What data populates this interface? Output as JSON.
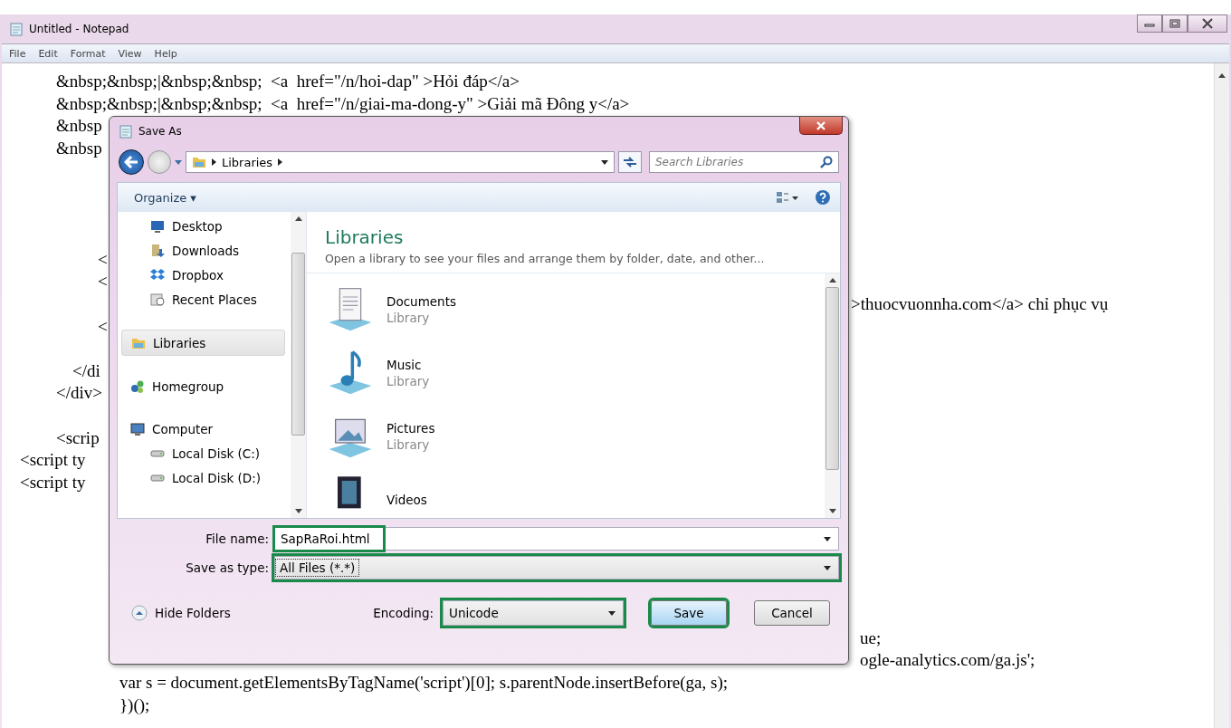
{
  "notepad": {
    "title": "Untitled - Notepad",
    "menu": [
      "File",
      "Edit",
      "Format",
      "View",
      "Help"
    ],
    "lines": [
      {
        "text": "&nbsp;&nbsp;|&nbsp;&nbsp;  <a  href=\"/n/hoi-dap\" >Hỏi đáp</a>"
      },
      {
        "text": "&nbsp;&nbsp;|&nbsp;&nbsp;  <a  href=\"/n/giai-ma-dong-y\" >Giải mã Đông y</a>"
      },
      {
        "text": "&nbsp"
      },
      {
        "text": "&nbsp"
      },
      {
        "text": "<"
      },
      {
        "text": "<"
      },
      {
        "text": ">thuocvuonnha.com</a> chỉ phục vụ"
      },
      {
        "text": "<"
      },
      {
        "text": "</di"
      },
      {
        "text": "</div>"
      },
      {
        "text": "<scrip"
      },
      {
        "text": "<script ty"
      },
      {
        "text": "<script ty"
      },
      {
        "text": "ue;"
      },
      {
        "text": "ogle-analytics.com/ga.js';"
      },
      {
        "text": "var s = document.getElementsByTagName('script')[0]; s.parentNode.insertBefore(ga, s);"
      },
      {
        "text": "})();"
      }
    ]
  },
  "dialog": {
    "title": "Save As",
    "address": "Libraries",
    "search": {
      "placeholder": "Search Libraries"
    },
    "organize": "Organize ▾",
    "nav_items": [
      {
        "label": "Desktop",
        "selected": false
      },
      {
        "label": "Downloads",
        "selected": false
      },
      {
        "label": "Dropbox",
        "selected": false
      },
      {
        "label": "Recent Places",
        "selected": false
      },
      {
        "label": "Libraries",
        "selected": true
      },
      {
        "label": "Homegroup",
        "selected": false
      },
      {
        "label": "Computer",
        "selected": false
      },
      {
        "label": "Local Disk (C:)",
        "selected": false
      },
      {
        "label": "Local Disk (D:)",
        "selected": false
      }
    ],
    "heading": "Libraries",
    "subtitle": "Open a library to see your files and arrange them by folder, date, and other...",
    "libraries": [
      {
        "name": "Documents",
        "type": "Library"
      },
      {
        "name": "Music",
        "type": "Library"
      },
      {
        "name": "Pictures",
        "type": "Library"
      },
      {
        "name": "Videos"
      }
    ],
    "file_name": {
      "label": "File name:",
      "value": "SapRaRoi.html",
      "highlighted": true
    },
    "save_type": {
      "label": "Save as type:",
      "value": "All Files  (*.*)",
      "highlighted": true
    },
    "hide_folders": "Hide Folders",
    "encoding": {
      "label": "Encoding:",
      "value": "Unicode",
      "highlighted": true
    },
    "buttons": [
      {
        "label": "Save",
        "highlighted": true
      },
      {
        "label": "Cancel",
        "highlighted": false
      }
    ]
  }
}
